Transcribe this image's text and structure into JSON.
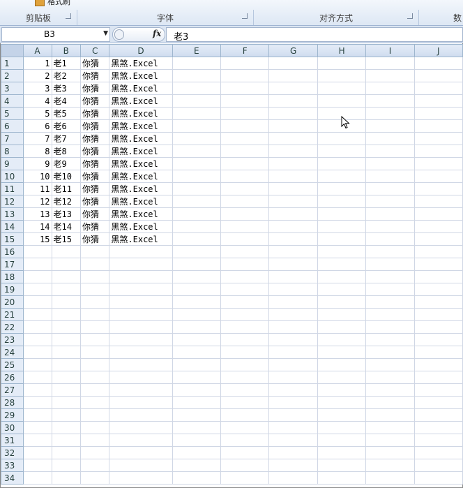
{
  "ribbon": {
    "format_painter": "格式刷",
    "groups": [
      "剪贴板",
      "字体",
      "对齐方式",
      "数"
    ]
  },
  "formula_bar": {
    "name_box": "B3",
    "fx_label": "fx",
    "formula": "老3"
  },
  "columns": [
    "A",
    "B",
    "C",
    "D",
    "E",
    "F",
    "G",
    "H",
    "I",
    "J"
  ],
  "rows": [
    {
      "n": "1",
      "a": "1",
      "b": "老1",
      "c": "你猜",
      "d": "黑煞.Excel"
    },
    {
      "n": "2",
      "a": "2",
      "b": "老2",
      "c": "你猜",
      "d": "黑煞.Excel"
    },
    {
      "n": "3",
      "a": "3",
      "b": "老3",
      "c": "你猜",
      "d": "黑煞.Excel"
    },
    {
      "n": "4",
      "a": "4",
      "b": "老4",
      "c": "你猜",
      "d": "黑煞.Excel"
    },
    {
      "n": "5",
      "a": "5",
      "b": "老5",
      "c": "你猜",
      "d": "黑煞.Excel"
    },
    {
      "n": "6",
      "a": "6",
      "b": "老6",
      "c": "你猜",
      "d": "黑煞.Excel"
    },
    {
      "n": "7",
      "a": "7",
      "b": "老7",
      "c": "你猜",
      "d": "黑煞.Excel"
    },
    {
      "n": "8",
      "a": "8",
      "b": "老8",
      "c": "你猜",
      "d": "黑煞.Excel"
    },
    {
      "n": "9",
      "a": "9",
      "b": "老9",
      "c": "你猜",
      "d": "黑煞.Excel"
    },
    {
      "n": "10",
      "a": "10",
      "b": "老10",
      "c": "你猜",
      "d": "黑煞.Excel"
    },
    {
      "n": "11",
      "a": "11",
      "b": "老11",
      "c": "你猜",
      "d": "黑煞.Excel"
    },
    {
      "n": "12",
      "a": "12",
      "b": "老12",
      "c": "你猜",
      "d": "黑煞.Excel"
    },
    {
      "n": "13",
      "a": "13",
      "b": "老13",
      "c": "你猜",
      "d": "黑煞.Excel"
    },
    {
      "n": "14",
      "a": "14",
      "b": "老14",
      "c": "你猜",
      "d": "黑煞.Excel"
    },
    {
      "n": "15",
      "a": "15",
      "b": "老15",
      "c": "你猜",
      "d": "黑煞.Excel"
    },
    {
      "n": "16"
    },
    {
      "n": "17"
    },
    {
      "n": "18"
    },
    {
      "n": "19"
    },
    {
      "n": "20"
    },
    {
      "n": "21"
    },
    {
      "n": "22"
    },
    {
      "n": "23"
    },
    {
      "n": "24"
    },
    {
      "n": "25"
    },
    {
      "n": "26"
    },
    {
      "n": "27"
    },
    {
      "n": "28"
    },
    {
      "n": "29"
    },
    {
      "n": "30"
    },
    {
      "n": "31"
    },
    {
      "n": "32"
    },
    {
      "n": "33"
    },
    {
      "n": "34"
    }
  ],
  "icons": {
    "format_painter": "paintbrush-icon",
    "launcher": "dialog-launcher-icon",
    "cursor": "mouse-pointer-icon"
  }
}
